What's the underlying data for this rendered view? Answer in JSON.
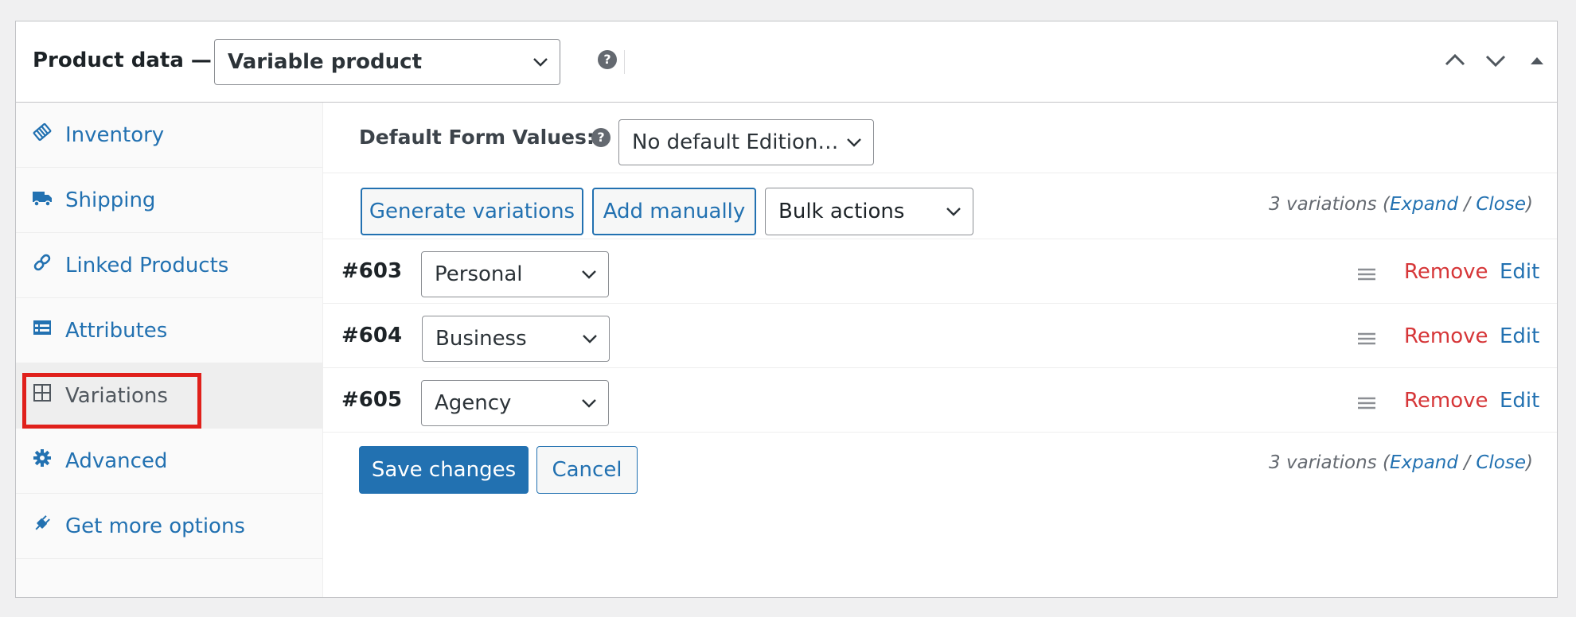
{
  "header": {
    "title": "Product data —",
    "product_type": "Variable product"
  },
  "sidebar": {
    "items": [
      {
        "label": "Inventory",
        "icon": "inventory-icon"
      },
      {
        "label": "Shipping",
        "icon": "truck-icon"
      },
      {
        "label": "Linked Products",
        "icon": "link-icon"
      },
      {
        "label": "Attributes",
        "icon": "attributes-icon"
      },
      {
        "label": "Variations",
        "icon": "grid-icon",
        "active": true
      },
      {
        "label": "Advanced",
        "icon": "gear-icon"
      },
      {
        "label": "Get more options",
        "icon": "plugin-icon"
      }
    ]
  },
  "defaults": {
    "label": "Default Form Values:",
    "value": "No default Edition…"
  },
  "toolbar": {
    "generate_label": "Generate variations",
    "add_label": "Add manually",
    "bulk_label": "Bulk actions"
  },
  "count": {
    "text": "3 variations",
    "expand": "Expand",
    "close": "Close"
  },
  "variations": [
    {
      "id": "#603",
      "value": "Personal"
    },
    {
      "id": "#604",
      "value": "Business"
    },
    {
      "id": "#605",
      "value": "Agency"
    }
  ],
  "row_actions": {
    "remove": "Remove",
    "edit": "Edit"
  },
  "footer": {
    "save_label": "Save changes",
    "cancel_label": "Cancel"
  },
  "colors": {
    "link": "#2271b1",
    "danger": "#d63638",
    "highlight": "#e0201b"
  }
}
